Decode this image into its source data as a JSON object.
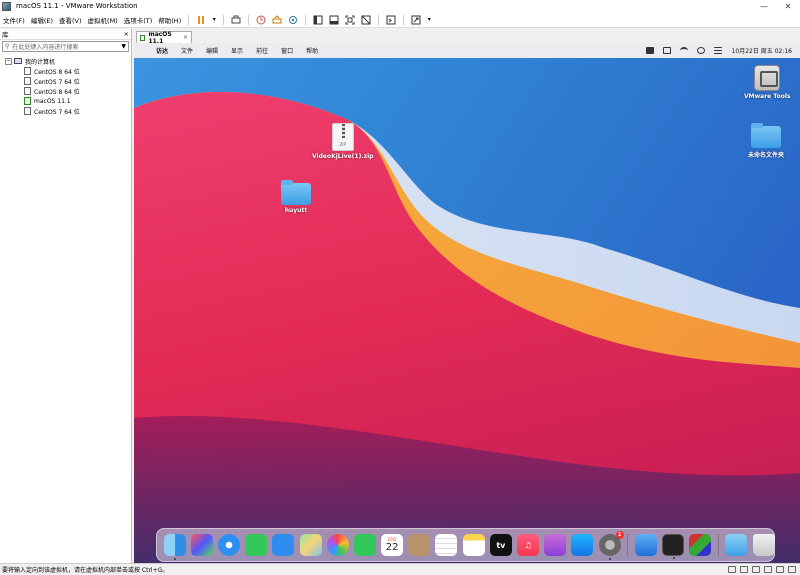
{
  "window": {
    "title": "macOS 11.1 - VMware Workstation"
  },
  "menubar": {
    "items": [
      "文件(F)",
      "编辑(E)",
      "查看(V)",
      "虚拟机(M)",
      "选项卡(T)",
      "帮助(H)"
    ]
  },
  "library": {
    "title": "库",
    "close": "×",
    "search_placeholder": "在此处键入内容进行搜索",
    "root": "我的计算机",
    "vms": [
      {
        "name": "CentOS 8 64 位",
        "running": false
      },
      {
        "name": "CentOS 7 64 位",
        "running": false
      },
      {
        "name": "CentOS 8 64 位",
        "running": false
      },
      {
        "name": "macOS 11.1",
        "running": true
      },
      {
        "name": "CentOS 7 64 位",
        "running": false
      }
    ]
  },
  "tab": {
    "label": "macOS 11.1",
    "close": "×"
  },
  "mac_menubar": {
    "apple": "",
    "items": [
      "访达",
      "文件",
      "编辑",
      "显示",
      "前往",
      "窗口",
      "帮助"
    ],
    "clock": "10月22日 周五  02:16"
  },
  "desktop": {
    "icons": {
      "zip": {
        "label": "VideoKjLive(1).zip",
        "tag": "ZIP"
      },
      "folder": {
        "label": "huyutt"
      },
      "vmtools": {
        "label": "VMware Tools"
      },
      "unnamed_folder": {
        "label": "未命名文件夹"
      }
    }
  },
  "dock": {
    "calendar": {
      "month": "10月",
      "day": "22"
    },
    "tv_label": "tv",
    "settings_badge": "1"
  },
  "statusbar": {
    "text": "要将输入定向到该虚拟机，请在虚拟机内部单击或按 Ctrl+G。"
  }
}
